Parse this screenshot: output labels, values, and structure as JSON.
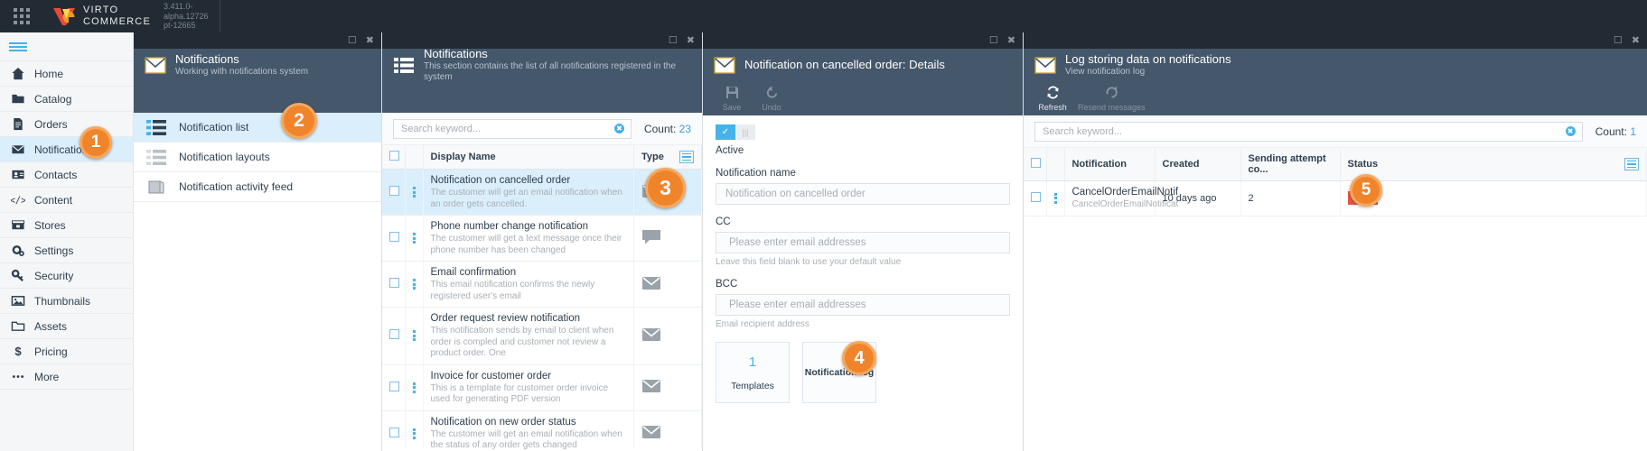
{
  "topbar": {
    "brand_line1": "VIRTO",
    "brand_line2": "COMMERCE",
    "version_line1": "3.411.0-",
    "version_line2": "alpha.12726",
    "version_line3": "pt-12665",
    "grid_icon": "app-grid-icon",
    "accent": "#f0962c"
  },
  "sidebar": {
    "hamburger": "hamburger-icon",
    "items": [
      {
        "label": "Home",
        "icon": "home-icon",
        "active": false
      },
      {
        "label": "Catalog",
        "icon": "folder-icon",
        "active": false
      },
      {
        "label": "Orders",
        "icon": "document-icon",
        "active": false
      },
      {
        "label": "Notifications",
        "icon": "envelope-icon",
        "active": true
      },
      {
        "label": "Contacts",
        "icon": "contact-card-icon",
        "active": false
      },
      {
        "label": "Content",
        "icon": "code-icon",
        "active": false
      },
      {
        "label": "Stores",
        "icon": "store-icon",
        "active": false
      },
      {
        "label": "Settings",
        "icon": "gear-icon",
        "active": false
      },
      {
        "label": "Security",
        "icon": "key-icon",
        "active": false
      },
      {
        "label": "Thumbnails",
        "icon": "image-icon",
        "active": false
      },
      {
        "label": "Assets",
        "icon": "folder-open-icon",
        "active": false
      },
      {
        "label": "Pricing",
        "icon": "dollar-icon",
        "active": false
      },
      {
        "label": "More",
        "icon": "ellipsis-icon",
        "active": false
      }
    ]
  },
  "blade_menu": {
    "title": "Notifications",
    "subtitle": "Working with notifications system",
    "icon": "envelope-icon",
    "maximize_icon": "maximize-icon",
    "close_icon": "close-icon",
    "items": [
      {
        "label": "Notification list",
        "icon": "list-icon",
        "active": true
      },
      {
        "label": "Notification layouts",
        "icon": "layout-list-icon",
        "active": false
      },
      {
        "label": "Notification activity feed",
        "icon": "feed-icon",
        "active": false
      }
    ]
  },
  "blade_list": {
    "title": "Notifications",
    "subtitle": "This section contains the list of all notifications registered in the system",
    "icon": "list-icon",
    "maximize_icon": "maximize-icon",
    "close_icon": "close-icon",
    "search_placeholder": "Search keyword...",
    "search_value": "",
    "clear_icon": "clear-icon",
    "count_label": "Count:",
    "count_value": "23",
    "columns": [
      "Display Name",
      "Type"
    ],
    "header_menu_icon": "column-options-icon",
    "rows": [
      {
        "name": "Notification on cancelled order",
        "desc": "The customer will get an email notification when an order gets cancelled.",
        "type": "email-icon",
        "selected": true
      },
      {
        "name": "Phone number change notification",
        "desc": "The customer will get a text message once their phone number has been changed",
        "type": "sms-icon",
        "selected": false
      },
      {
        "name": "Email confirmation",
        "desc": "This email notification confirms the newly registered user's email",
        "type": "email-icon",
        "selected": false
      },
      {
        "name": "Order request review notification",
        "desc": "This notification sends by email to client when order is compled and customer not review a product order. One",
        "type": "email-icon",
        "selected": false
      },
      {
        "name": "Invoice for customer order",
        "desc": "This is a template for customer order invoice used for generating PDF version",
        "type": "email-icon",
        "selected": false
      },
      {
        "name": "Notification on new order status",
        "desc": "The customer will get an email notification when the status of any order gets changed",
        "type": "email-icon",
        "selected": false
      }
    ]
  },
  "blade_details": {
    "title": "Notification on cancelled order: Details",
    "icon": "envelope-icon",
    "maximize_icon": "maximize-icon",
    "close_icon": "close-icon",
    "toolbar": [
      {
        "label": "Save",
        "icon": "save-icon",
        "disabled": true
      },
      {
        "label": "Undo",
        "icon": "undo-icon",
        "disabled": true
      }
    ],
    "toggle_label": "Active",
    "toggle_on": true,
    "fields": [
      {
        "label": "Notification name",
        "placeholder": "Notification on cancelled order",
        "value": "",
        "hint": ""
      },
      {
        "label": "CC",
        "placeholder": "Please enter email addresses",
        "value": "",
        "hint": "Leave this field blank to use your default value"
      },
      {
        "label": "BCC",
        "placeholder": "Please enter email addresses",
        "value": "",
        "hint": "Email recipient address"
      }
    ],
    "tiles": [
      {
        "number": "1",
        "label": "Templates"
      },
      {
        "number": "",
        "label": "Notification log"
      }
    ]
  },
  "blade_log": {
    "title": "Log storing data on notifications",
    "subtitle": "View notification log",
    "icon": "envelope-icon",
    "maximize_icon": "maximize-icon",
    "close_icon": "close-icon",
    "toolbar": [
      {
        "label": "Refresh",
        "icon": "refresh-icon",
        "disabled": false
      },
      {
        "label": "Resend messages",
        "icon": "resend-icon",
        "disabled": true
      }
    ],
    "search_placeholder": "Search keyword...",
    "search_value": "",
    "clear_icon": "clear-icon",
    "count_label": "Count:",
    "count_value": "1",
    "columns": [
      "Notification",
      "Created",
      "Sending attempt co...",
      "Status"
    ],
    "header_menu_icon": "column-options-icon",
    "rows": [
      {
        "notification": "CancelOrderEmailNotif",
        "notification_sub": "CancelOrderEmailNotificat",
        "created": "10 days ago",
        "attempts": "2",
        "status": "Error"
      }
    ]
  },
  "markers": [
    {
      "num": "1"
    },
    {
      "num": "2"
    },
    {
      "num": "3"
    },
    {
      "num": "4"
    },
    {
      "num": "5"
    }
  ]
}
